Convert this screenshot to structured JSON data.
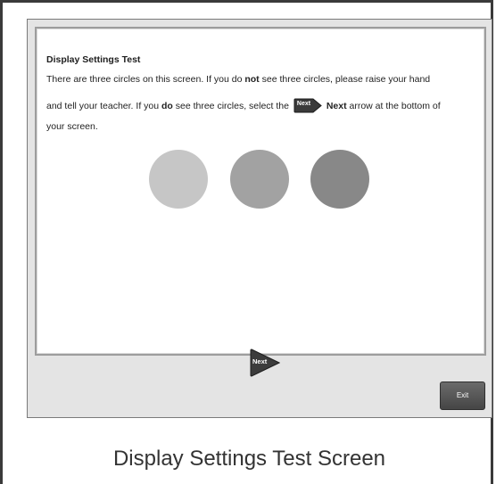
{
  "panel": {
    "title": "Display Settings Test",
    "line1_pre": "There are three circles on this screen. If you do ",
    "line1_bold": "not",
    "line1_post": " see three circles, please raise your hand",
    "line2_pre": "and tell your teacher. If you ",
    "line2_bold": "do",
    "line2_mid": " see three circles, select the ",
    "line2_next_bold": "Next",
    "line2_post": " arrow at the bottom of",
    "line3": "your screen.",
    "circle_colors": [
      "#c6c6c6",
      "#a2a2a2",
      "#888888"
    ]
  },
  "icons": {
    "inline_next_icon": "next-arrow-icon",
    "next_label": "Next"
  },
  "footer": {
    "next_button_label": "Next",
    "exit_button_label": "Exit"
  },
  "caption": "Display Settings Test Screen"
}
